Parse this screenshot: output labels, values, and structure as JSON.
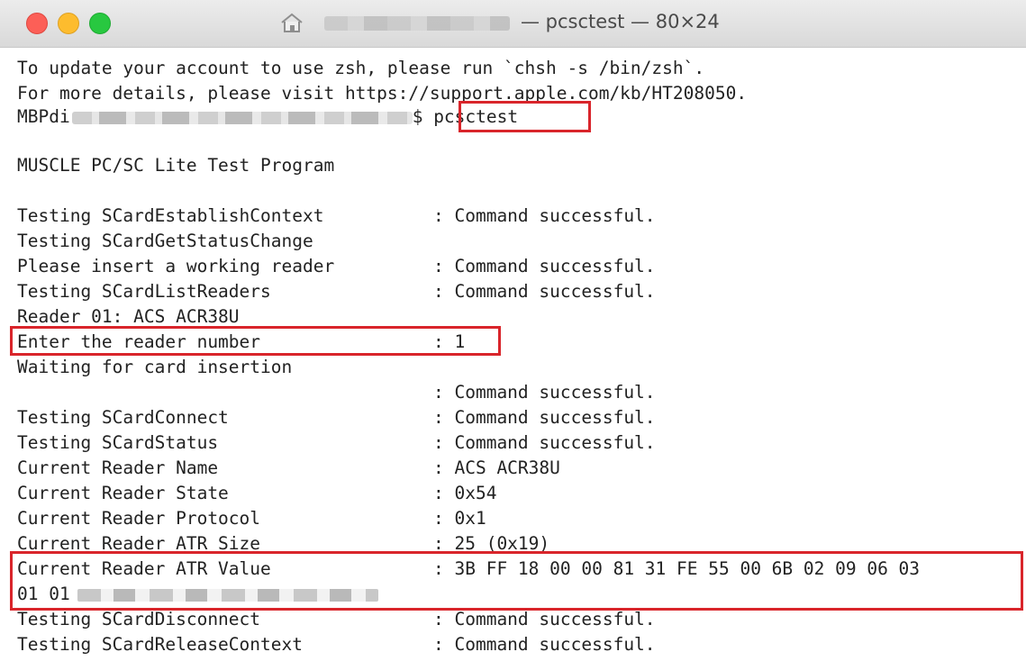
{
  "window": {
    "title": "— pcsctest — 80×24",
    "home_icon": "home-folder-icon",
    "traffic_lights": [
      "close",
      "minimize",
      "maximize"
    ]
  },
  "terminal": {
    "line1": "To update your account to use zsh, please run `chsh -s /bin/zsh`.",
    "line2": "For more details, please visit https://support.apple.com/kb/HT208050.",
    "prompt_prefix": "MBPdi",
    "prompt_suffix": "$ ",
    "command": "pcsctest",
    "program_title": "MUSCLE PC/SC Lite Test Program",
    "rows": [
      {
        "label": "Testing SCardEstablishContext",
        "value": ": Command successful."
      },
      {
        "label": "Testing SCardGetStatusChange",
        "value": ""
      },
      {
        "label": "Please insert a working reader",
        "value": ": Command successful."
      },
      {
        "label": "Testing SCardListReaders",
        "value": ": Command successful."
      },
      {
        "label": "Reader 01: ACS ACR38U",
        "value": ""
      },
      {
        "label": "Enter the reader number",
        "value": ": 1"
      },
      {
        "label": "Waiting for card insertion",
        "value": ""
      },
      {
        "label": "",
        "value": ": Command successful."
      },
      {
        "label": "Testing SCardConnect",
        "value": ": Command successful."
      },
      {
        "label": "Testing SCardStatus",
        "value": ": Command successful."
      },
      {
        "label": "Current Reader Name",
        "value": ": ACS ACR38U"
      },
      {
        "label": "Current Reader State",
        "value": ": 0x54"
      },
      {
        "label": "Current Reader Protocol",
        "value": ": 0x1"
      },
      {
        "label": "Current Reader ATR Size",
        "value": ": 25 (0x19)"
      },
      {
        "label": "Current Reader ATR Value",
        "value": ": 3B FF 18 00 00 81 31 FE 55 00 6B 02 09 06 03"
      },
      {
        "label": "01 01",
        "value": ""
      },
      {
        "label": "Testing SCardDisconnect",
        "value": ": Command successful."
      },
      {
        "label": "Testing SCardReleaseContext",
        "value": ": Command successful."
      }
    ]
  },
  "colors": {
    "highlight": "#d9252b",
    "text": "#222222"
  }
}
